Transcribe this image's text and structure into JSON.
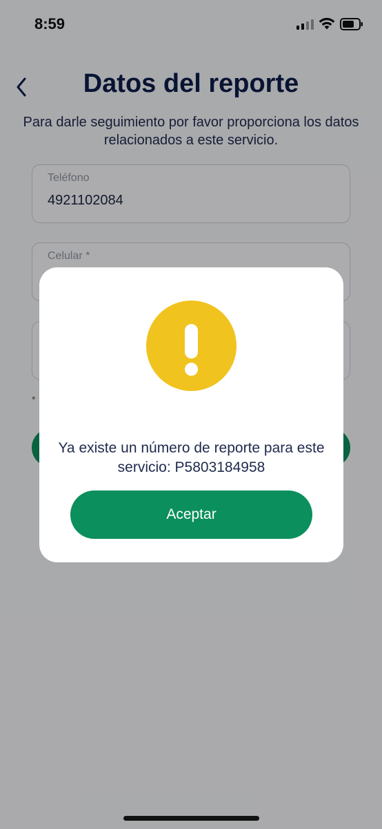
{
  "status_bar": {
    "time": "8:59",
    "icons": [
      "signal-icon",
      "wifi-icon",
      "battery-icon"
    ]
  },
  "header": {
    "back_icon": "chevron-left-icon",
    "title": "Datos del reporte",
    "subtitle": "Para darle seguimiento por favor proporciona los datos relacionados a este servicio."
  },
  "form": {
    "fields": [
      {
        "label": "Teléfono",
        "value": "4921102084"
      },
      {
        "label": "Celular *",
        "value": ""
      },
      {
        "label": "",
        "value": ""
      }
    ],
    "note": "*"
  },
  "modal": {
    "icon": "warning-icon",
    "message": "Ya existe un número de reporte para este servicio: P5803184958",
    "accept_label": "Aceptar"
  },
  "colors": {
    "primary_green": "#0b8f5c",
    "warning_yellow": "#f0c31e",
    "title_navy": "#0e1e49"
  }
}
